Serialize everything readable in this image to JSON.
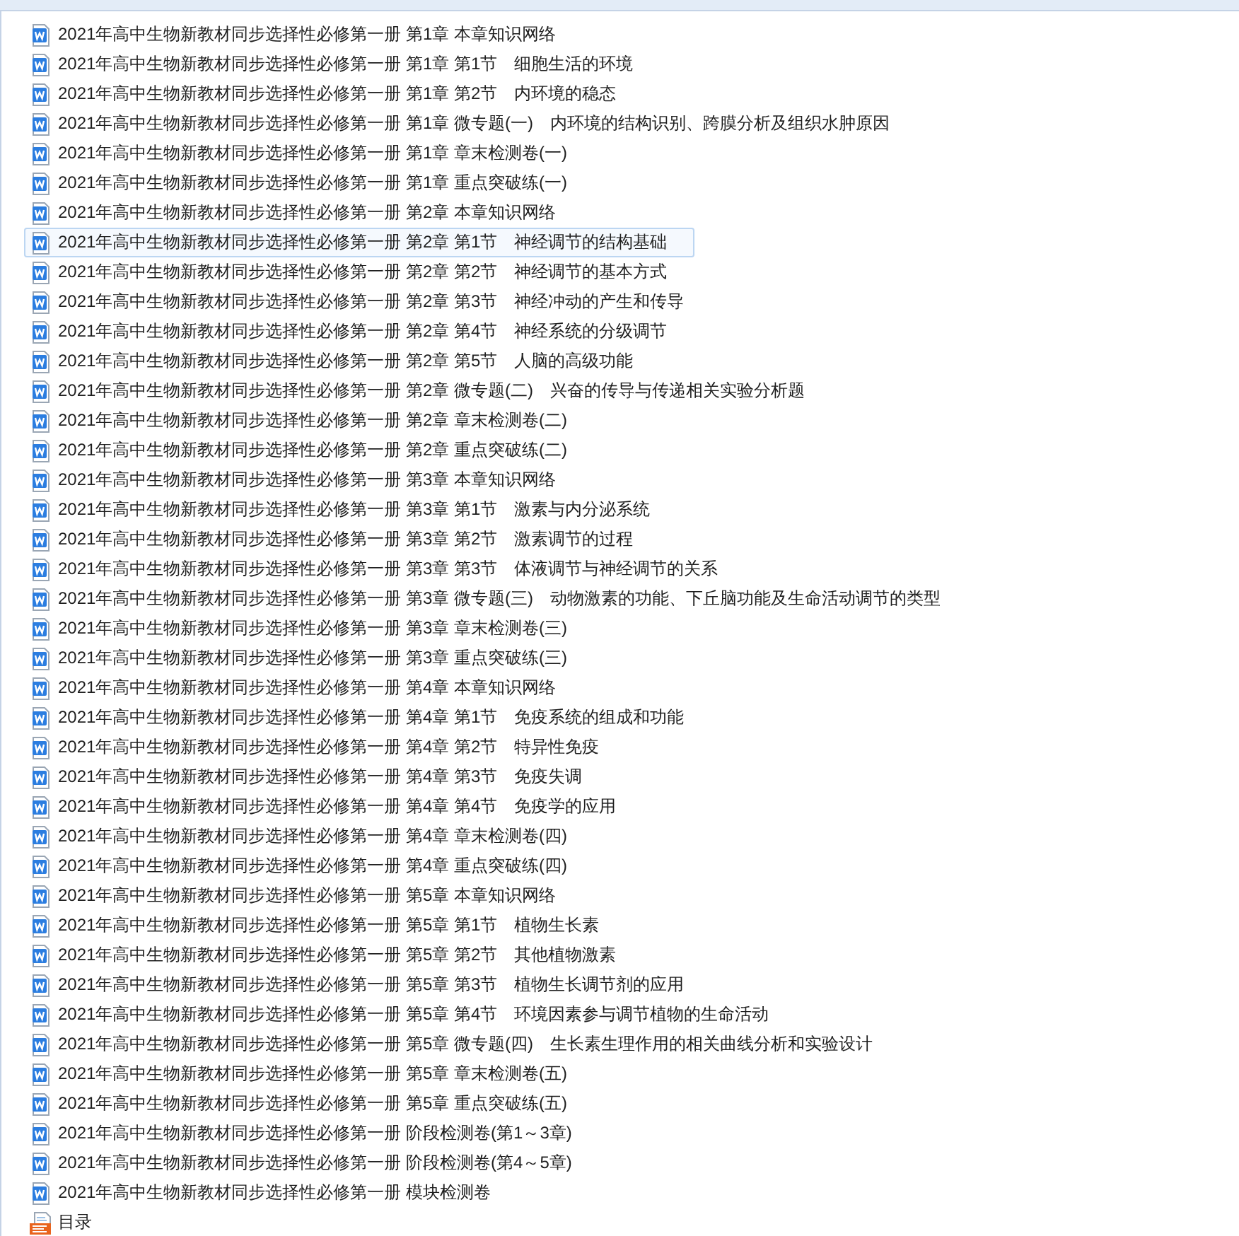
{
  "files": [
    {
      "name": "2021年高中生物新教材同步选择性必修第一册 第1章 本章知识网络",
      "kind": "word",
      "hovered": false
    },
    {
      "name": "2021年高中生物新教材同步选择性必修第一册 第1章 第1节　细胞生活的环境",
      "kind": "word",
      "hovered": false
    },
    {
      "name": "2021年高中生物新教材同步选择性必修第一册 第1章 第2节　内环境的稳态",
      "kind": "word",
      "hovered": false
    },
    {
      "name": "2021年高中生物新教材同步选择性必修第一册 第1章 微专题(一)　内环境的结构识别、跨膜分析及组织水肿原因",
      "kind": "word",
      "hovered": false
    },
    {
      "name": "2021年高中生物新教材同步选择性必修第一册 第1章 章末检测卷(一)",
      "kind": "word",
      "hovered": false
    },
    {
      "name": "2021年高中生物新教材同步选择性必修第一册 第1章 重点突破练(一)",
      "kind": "word",
      "hovered": false
    },
    {
      "name": "2021年高中生物新教材同步选择性必修第一册 第2章 本章知识网络",
      "kind": "word",
      "hovered": false
    },
    {
      "name": "2021年高中生物新教材同步选择性必修第一册 第2章 第1节　神经调节的结构基础",
      "kind": "word",
      "hovered": true
    },
    {
      "name": "2021年高中生物新教材同步选择性必修第一册 第2章 第2节　神经调节的基本方式",
      "kind": "word",
      "hovered": false
    },
    {
      "name": "2021年高中生物新教材同步选择性必修第一册 第2章 第3节　神经冲动的产生和传导",
      "kind": "word",
      "hovered": false
    },
    {
      "name": "2021年高中生物新教材同步选择性必修第一册 第2章 第4节　神经系统的分级调节",
      "kind": "word",
      "hovered": false
    },
    {
      "name": "2021年高中生物新教材同步选择性必修第一册 第2章 第5节　人脑的高级功能",
      "kind": "word",
      "hovered": false
    },
    {
      "name": "2021年高中生物新教材同步选择性必修第一册 第2章 微专题(二)　兴奋的传导与传递相关实验分析题",
      "kind": "word",
      "hovered": false
    },
    {
      "name": "2021年高中生物新教材同步选择性必修第一册 第2章 章末检测卷(二)",
      "kind": "word",
      "hovered": false
    },
    {
      "name": "2021年高中生物新教材同步选择性必修第一册 第2章 重点突破练(二)",
      "kind": "word",
      "hovered": false
    },
    {
      "name": "2021年高中生物新教材同步选择性必修第一册 第3章 本章知识网络",
      "kind": "word",
      "hovered": false
    },
    {
      "name": "2021年高中生物新教材同步选择性必修第一册 第3章 第1节　激素与内分泌系统",
      "kind": "word",
      "hovered": false
    },
    {
      "name": "2021年高中生物新教材同步选择性必修第一册 第3章 第2节　激素调节的过程",
      "kind": "word",
      "hovered": false
    },
    {
      "name": "2021年高中生物新教材同步选择性必修第一册 第3章 第3节　体液调节与神经调节的关系",
      "kind": "word",
      "hovered": false
    },
    {
      "name": "2021年高中生物新教材同步选择性必修第一册 第3章 微专题(三)　动物激素的功能、下丘脑功能及生命活动调节的类型",
      "kind": "word",
      "hovered": false
    },
    {
      "name": "2021年高中生物新教材同步选择性必修第一册 第3章 章末检测卷(三)",
      "kind": "word",
      "hovered": false
    },
    {
      "name": "2021年高中生物新教材同步选择性必修第一册 第3章 重点突破练(三)",
      "kind": "word",
      "hovered": false
    },
    {
      "name": "2021年高中生物新教材同步选择性必修第一册 第4章 本章知识网络",
      "kind": "word",
      "hovered": false
    },
    {
      "name": "2021年高中生物新教材同步选择性必修第一册 第4章 第1节　免疫系统的组成和功能",
      "kind": "word",
      "hovered": false
    },
    {
      "name": "2021年高中生物新教材同步选择性必修第一册 第4章 第2节　特异性免疫",
      "kind": "word",
      "hovered": false
    },
    {
      "name": "2021年高中生物新教材同步选择性必修第一册 第4章 第3节　免疫失调",
      "kind": "word",
      "hovered": false
    },
    {
      "name": "2021年高中生物新教材同步选择性必修第一册 第4章 第4节　免疫学的应用",
      "kind": "word",
      "hovered": false
    },
    {
      "name": "2021年高中生物新教材同步选择性必修第一册 第4章 章末检测卷(四)",
      "kind": "word",
      "hovered": false
    },
    {
      "name": "2021年高中生物新教材同步选择性必修第一册 第4章 重点突破练(四)",
      "kind": "word",
      "hovered": false
    },
    {
      "name": "2021年高中生物新教材同步选择性必修第一册 第5章 本章知识网络",
      "kind": "word",
      "hovered": false
    },
    {
      "name": "2021年高中生物新教材同步选择性必修第一册 第5章 第1节　植物生长素",
      "kind": "word",
      "hovered": false
    },
    {
      "name": "2021年高中生物新教材同步选择性必修第一册 第5章 第2节　其他植物激素",
      "kind": "word",
      "hovered": false
    },
    {
      "name": "2021年高中生物新教材同步选择性必修第一册 第5章 第3节　植物生长调节剂的应用",
      "kind": "word",
      "hovered": false
    },
    {
      "name": "2021年高中生物新教材同步选择性必修第一册 第5章 第4节　环境因素参与调节植物的生命活动",
      "kind": "word",
      "hovered": false
    },
    {
      "name": "2021年高中生物新教材同步选择性必修第一册 第5章 微专题(四)　生长素生理作用的相关曲线分析和实验设计",
      "kind": "word",
      "hovered": false
    },
    {
      "name": "2021年高中生物新教材同步选择性必修第一册 第5章 章末检测卷(五)",
      "kind": "word",
      "hovered": false
    },
    {
      "name": "2021年高中生物新教材同步选择性必修第一册 第5章 重点突破练(五)",
      "kind": "word",
      "hovered": false
    },
    {
      "name": "2021年高中生物新教材同步选择性必修第一册 阶段检测卷(第1～3章)",
      "kind": "word",
      "hovered": false
    },
    {
      "name": "2021年高中生物新教材同步选择性必修第一册 阶段检测卷(第4～5章)",
      "kind": "word",
      "hovered": false
    },
    {
      "name": "2021年高中生物新教材同步选择性必修第一册 模块检测卷",
      "kind": "word",
      "hovered": false
    },
    {
      "name": "目录",
      "kind": "image",
      "hovered": false
    }
  ]
}
